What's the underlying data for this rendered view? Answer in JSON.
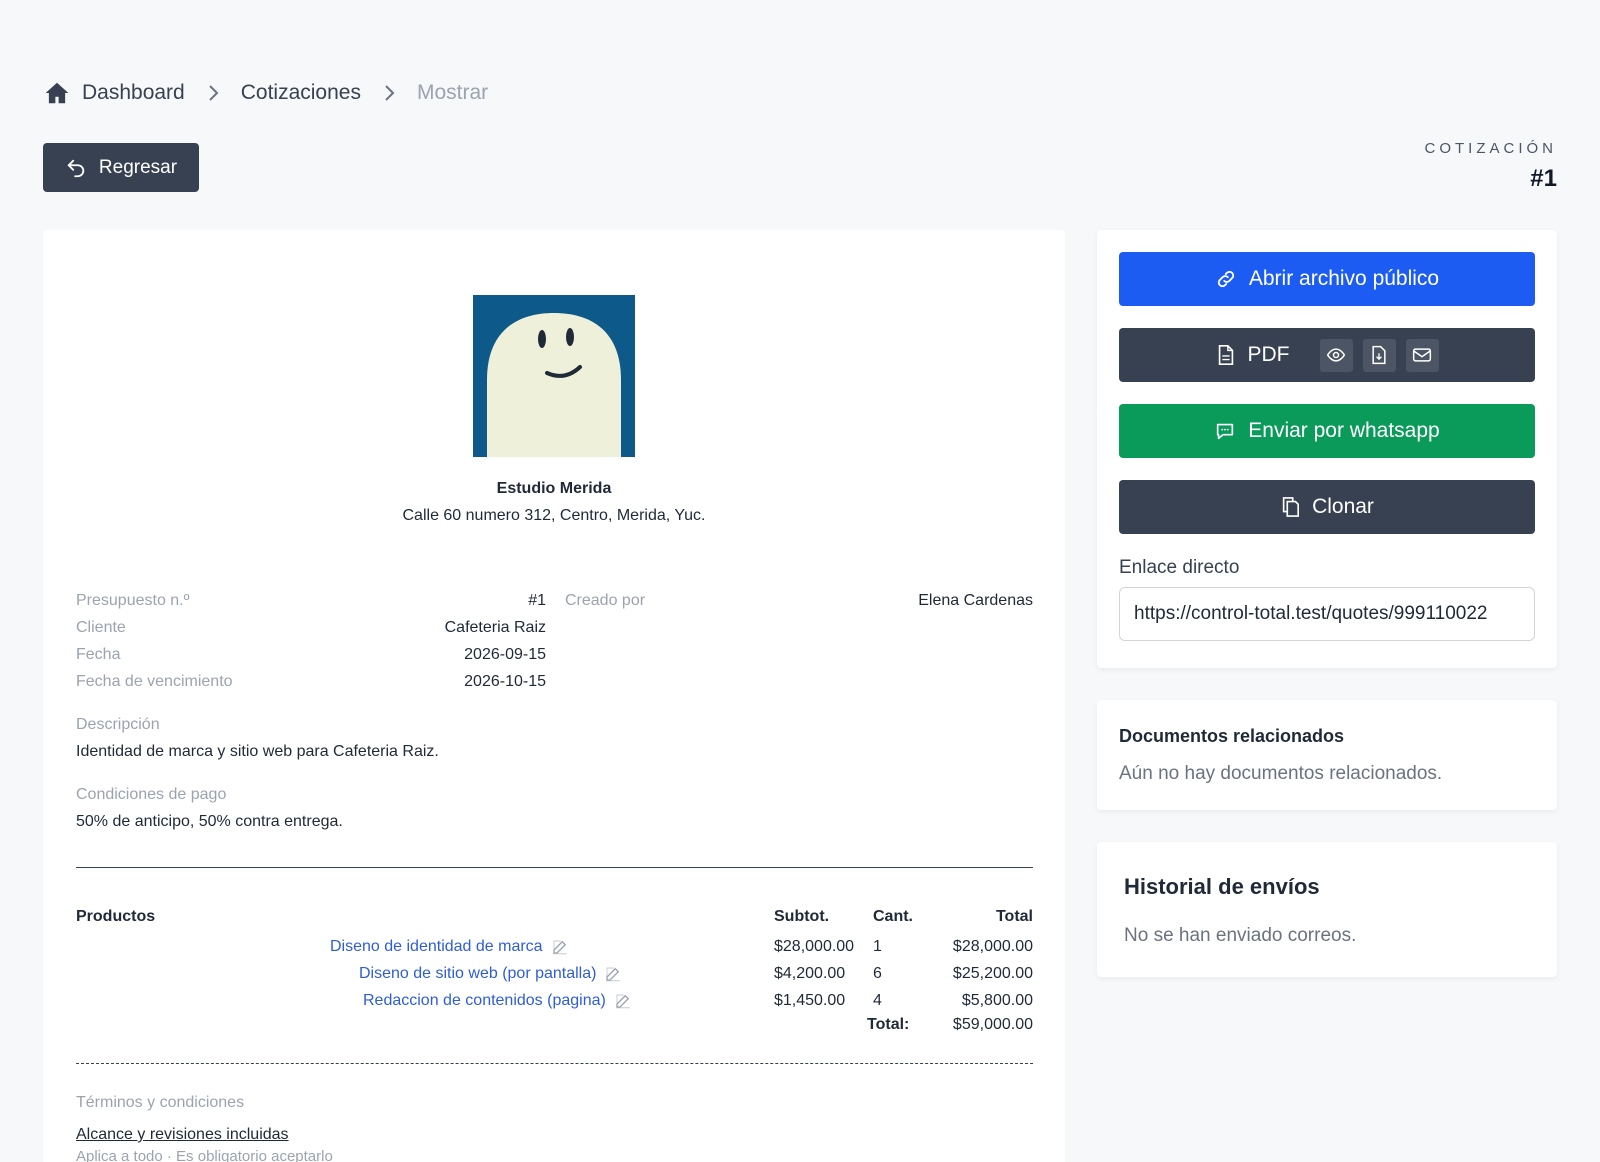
{
  "breadcrumb": {
    "items": [
      "Dashboard",
      "Cotizaciones",
      "Mostrar"
    ]
  },
  "back_button": {
    "label": "Regresar"
  },
  "quote": {
    "kicker": "COTIZACIÓN",
    "number": "#1"
  },
  "company": {
    "name": "Estudio Merida",
    "address": "Calle 60 numero 312, Centro, Merida, Yuc."
  },
  "details": {
    "budget_label": "Presupuesto n.º",
    "budget_value": "#1",
    "client_label": "Cliente",
    "client_value": "Cafeteria Raiz",
    "date_label": "Fecha",
    "date_value": "2026-09-15",
    "due_label": "Fecha de vencimiento",
    "due_value": "2026-10-15",
    "created_by_label": "Creado por",
    "created_by_value": "Elena Cardenas"
  },
  "description": {
    "label": "Descripción",
    "text": "Identidad de marca y sitio web para Cafeteria Raiz."
  },
  "payment": {
    "label": "Condiciones de pago",
    "text": "50% de anticipo, 50% contra entrega."
  },
  "products": {
    "headers": {
      "name": "Productos",
      "subtotal": "Subtot.",
      "qty": "Cant.",
      "total": "Total"
    },
    "rows": [
      {
        "name": "Diseno de identidad de marca",
        "subtotal": "$28,000.00",
        "qty": "1",
        "total": "$28,000.00"
      },
      {
        "name": "Diseno de sitio web (por pantalla)",
        "subtotal": "$4,200.00",
        "qty": "6",
        "total": "$25,200.00"
      },
      {
        "name": "Redaccion de contenidos (pagina)",
        "subtotal": "$1,450.00",
        "qty": "4",
        "total": "$5,800.00"
      }
    ],
    "total_label": "Total:",
    "total_value": "$59,000.00"
  },
  "terms": {
    "label": "Términos y condiciones",
    "title": "Alcance y revisiones incluidas",
    "subtitle": "Aplica a todo · Es obligatorio aceptarlo"
  },
  "actions": {
    "open_public": "Abrir archivo público",
    "pdf": "PDF",
    "whatsapp": "Enviar por whatsapp",
    "clone": "Clonar",
    "direct_link_label": "Enlace directo",
    "direct_link_value": "https://control-total.test/quotes/999110022"
  },
  "related": {
    "title": "Documentos relacionados",
    "empty": "Aún no hay documentos relacionados."
  },
  "history": {
    "title": "Historial de envíos",
    "empty": "No se han enviado correos."
  },
  "colors": {
    "primary": "#1d5cf2",
    "dark": "#374151",
    "success": "#0a9a5a",
    "link": "#2f5dd6"
  },
  "icons": [
    "home-icon",
    "chevron-right-icon",
    "undo-icon",
    "link-icon",
    "file-icon",
    "eye-icon",
    "file-download-icon",
    "mail-icon",
    "chat-icon",
    "copy-icon",
    "edit-icon"
  ]
}
